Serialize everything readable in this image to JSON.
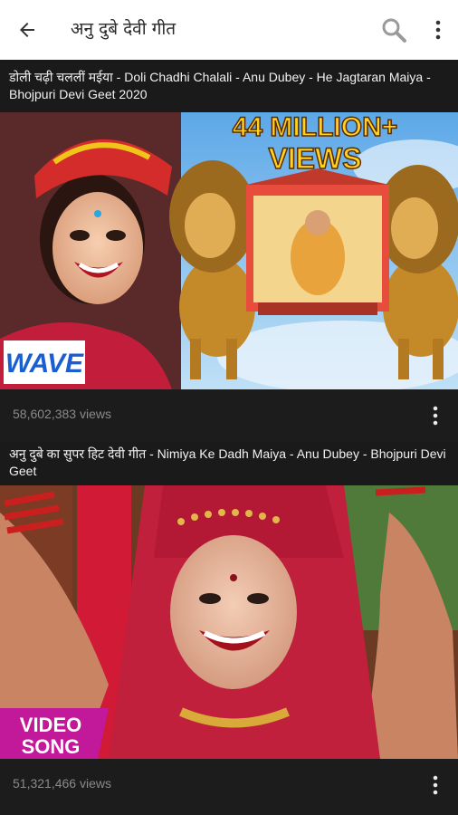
{
  "appbar": {
    "title": "अनु दुबे देवी गीत",
    "back_icon": "arrow-back-icon",
    "search_icon": "search-icon",
    "menu_icon": "more-vertical-icon"
  },
  "videos": [
    {
      "title": "डोली चढ़ी चललीं मईया - Doli Chadhi Chalali - Anu Dubey - He Jagtaran Maiya - Bhojpuri Devi Geet 2020",
      "overlay_text_line1": "44 MILLION+",
      "overlay_text_line2": "VIEWS",
      "logo_text": "WAVE",
      "views": "58,602,383 views"
    },
    {
      "title": "अनु दुबे का सुपर हिट देवी गीत - Nimiya Ke Dadh Maiya - Anu Dubey - Bhojpuri Devi Geet",
      "badge_line1": "VIDEO",
      "badge_line2": "SONG",
      "views": "51,321,466 views"
    }
  ],
  "colors": {
    "appbar_bg": "#ffffff",
    "list_bg": "#1c1c1c",
    "views_text": "#8a8a8a",
    "overlay_yellow": "#ffd21f",
    "badge_magenta": "#c2189a"
  }
}
